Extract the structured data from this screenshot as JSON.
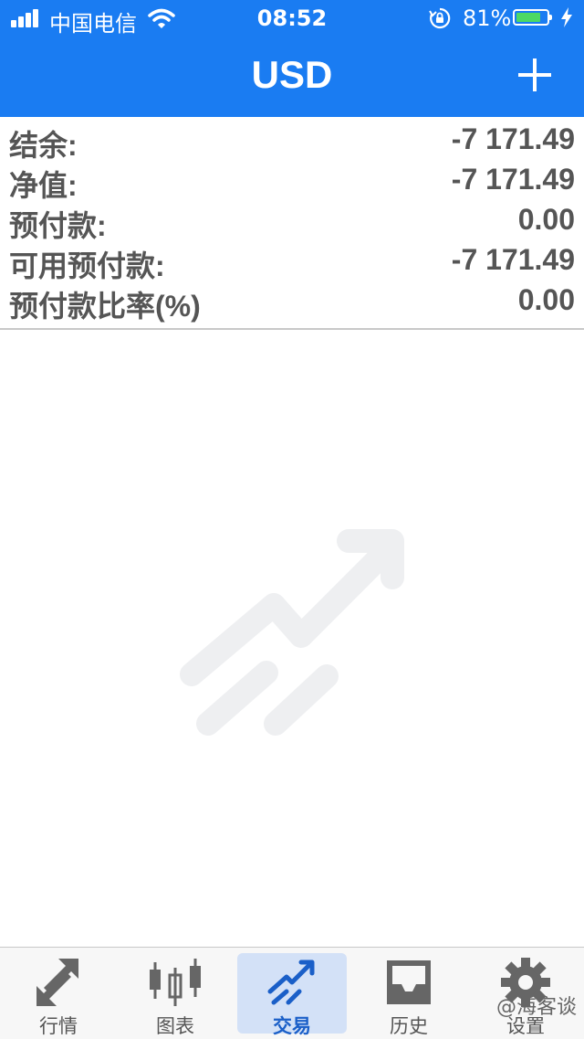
{
  "status_bar": {
    "carrier": "中国电信",
    "time": "08:52",
    "battery_percent": "81%",
    "battery_level": 0.81
  },
  "header": {
    "title": "USD"
  },
  "account": [
    {
      "label": "结余:",
      "value": "-7 171.49"
    },
    {
      "label": "净值:",
      "value": "-7 171.49"
    },
    {
      "label": "预付款:",
      "value": "0.00"
    },
    {
      "label": "可用预付款:",
      "value": "-7 171.49"
    },
    {
      "label": "预付款比率(%)",
      "value": "0.00"
    }
  ],
  "tabs": [
    {
      "label": "行情",
      "icon": "quotes-arrows-icon"
    },
    {
      "label": "图表",
      "icon": "candlestick-chart-icon"
    },
    {
      "label": "交易",
      "icon": "trade-trend-icon",
      "active": true
    },
    {
      "label": "历史",
      "icon": "history-inbox-icon"
    },
    {
      "label": "设置",
      "icon": "gear-icon"
    }
  ],
  "watermark": "@海客谈",
  "colors": {
    "header_bg": "#1a7cf2",
    "active_tab_bg": "#d3e1f7",
    "active_tab_text": "#1a5fc8",
    "battery_fill": "#4cd964"
  }
}
